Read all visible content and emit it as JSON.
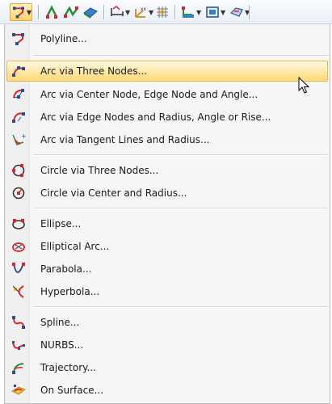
{
  "toolbar": {
    "items": [
      {
        "icon": "line-tool-icon",
        "active": true,
        "dropdown": true
      },
      {
        "icon": "members-icon"
      },
      {
        "icon": "member-sets-icon"
      },
      {
        "icon": "surfaces-icon"
      },
      {
        "icon": "dimension-icon",
        "dropdown": true
      },
      {
        "icon": "coordinate-system-icon",
        "dropdown": true
      },
      {
        "icon": "grid-icon"
      },
      {
        "icon": "support-icon",
        "dropdown": true
      },
      {
        "icon": "view-icon",
        "dropdown": true
      },
      {
        "icon": "visibility-icon",
        "dropdown": true
      }
    ]
  },
  "menu": {
    "items": [
      {
        "label": "Polyline...",
        "icon": "polyline-icon"
      },
      {
        "label": "Arc via Three Nodes...",
        "icon": "arc-three-nodes-icon",
        "highlighted": true
      },
      {
        "label": "Arc via Center Node, Edge Node and Angle...",
        "icon": "arc-center-node-icon"
      },
      {
        "label": "Arc via Edge Nodes and Radius, Angle or Rise...",
        "icon": "arc-edge-nodes-icon"
      },
      {
        "label": "Arc via Tangent Lines and Radius...",
        "icon": "arc-tangent-lines-icon"
      },
      {
        "label": "Circle via Three Nodes...",
        "icon": "circle-three-nodes-icon"
      },
      {
        "label": "Circle via Center and Radius...",
        "icon": "circle-center-radius-icon"
      },
      {
        "label": "Ellipse...",
        "icon": "ellipse-icon"
      },
      {
        "label": "Elliptical Arc...",
        "icon": "elliptical-arc-icon"
      },
      {
        "label": "Parabola...",
        "icon": "parabola-icon"
      },
      {
        "label": "Hyperbola...",
        "icon": "hyperbola-icon"
      },
      {
        "label": "Spline...",
        "icon": "spline-icon"
      },
      {
        "label": "NURBS...",
        "icon": "nurbs-icon"
      },
      {
        "label": "Trajectory...",
        "icon": "trajectory-icon"
      },
      {
        "label": "On Surface...",
        "icon": "on-surface-icon"
      }
    ]
  },
  "colors": {
    "highlight": "#ffe7a6",
    "highlight_border": "#e8b64a",
    "node_red": "#d8262c",
    "curve_blue": "#2a4f8f",
    "surface_yellow": "#f1c232"
  }
}
